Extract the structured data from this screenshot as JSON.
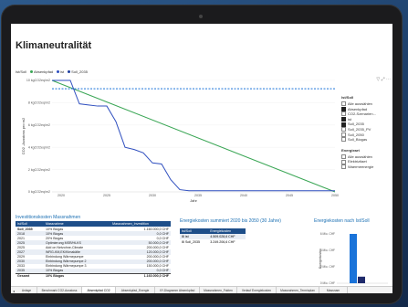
{
  "title": "Klimaneutralität",
  "legend": {
    "label": "Ist/Soll",
    "items": [
      {
        "label": "Absenkpfad",
        "color": "#3aa655"
      },
      {
        "label": "ist",
        "color": "#2f4fbf"
      },
      {
        "label": "Soll_2035",
        "color": "#1f3f9f"
      }
    ]
  },
  "chart_data": [
    {
      "type": "line",
      "ylabel": "CO2 -Ausstoss pro m2",
      "xlabel": "Jahr",
      "yticks": [
        "10 kgCO2eq/m2",
        "8 kgCO2eq/m2",
        "6 kgCO2eq/m2",
        "4 kgCO2eq/m2",
        "2 kgCO2eq/m2",
        "0 kgCO2eq/m2"
      ],
      "xticks": [
        "2020",
        "2025",
        "2030",
        "2035",
        "2040",
        "2045",
        "2050"
      ],
      "ylim": [
        0,
        10
      ],
      "xlim": [
        2019,
        2050
      ],
      "series": [
        {
          "name": "Absenkpfad",
          "color": "#3aa655",
          "style": "solid",
          "x": [
            2019,
            2050
          ],
          "y": [
            10,
            0
          ]
        },
        {
          "name": "ist",
          "color": "#2f4fbf",
          "style": "solid",
          "x": [
            2019,
            2021,
            2022,
            2023,
            2024,
            2025,
            2026,
            2027,
            2028,
            2029,
            2030,
            2031,
            2032,
            2033,
            2034,
            2035,
            2050
          ],
          "y": [
            10,
            10,
            7.9,
            7.8,
            7.7,
            7.7,
            6.3,
            4.0,
            3.8,
            3.5,
            2.6,
            2.5,
            1.1,
            0.2,
            0.1,
            0.1,
            0.1
          ]
        },
        {
          "name": "Soll_2035",
          "color": "#1a73d9",
          "style": "dashed",
          "x": [
            2019,
            2050
          ],
          "y": [
            9.25,
            9.25
          ]
        }
      ]
    },
    {
      "type": "bar",
      "title": "Energiekosten nach Ist/Soll",
      "ylabel": "Energiekosten",
      "yticks": [
        "6 Mio. CHF",
        "4 Mio. CHF",
        "2 Mio. CHF",
        "0 Mio. CHF"
      ],
      "ylim": [
        0,
        6
      ],
      "series": [
        {
          "name": "ist",
          "values": [
            6.0
          ],
          "color": "#1a73d9"
        },
        {
          "name": "Soll_2035",
          "values": [
            0.8
          ],
          "color": "#1f2a6b"
        }
      ]
    }
  ],
  "right_panel": {
    "icons": [
      "filter-icon",
      "focus-icon",
      "more-icon"
    ],
    "istsoll_header": "Ist/Soll",
    "istsoll_items": [
      {
        "label": "Alle auswählen",
        "checked": false
      },
      {
        "label": "Absenkpfad",
        "checked": true
      },
      {
        "label": "CO2-Szenarien...",
        "checked": false
      },
      {
        "label": "ist",
        "checked": true
      },
      {
        "label": "Soll_2035",
        "checked": true
      },
      {
        "label": "Soll_2035_PV",
        "checked": false
      },
      {
        "label": "Soll_2050",
        "checked": false
      },
      {
        "label": "Soll_Biogas",
        "checked": false
      }
    ],
    "energieart_header": "Energieart",
    "energieart_items": [
      {
        "label": "Alle auswählen",
        "checked": false
      },
      {
        "label": "Elektrizitaet",
        "checked": false
      },
      {
        "label": "Waermeenergie",
        "checked": false
      }
    ]
  },
  "investment": {
    "title": "Investitionskosten Massnahmen",
    "headers": [
      "Ist/Soll",
      "Massnahme",
      "Massnahmen_Investition"
    ],
    "rows": [
      [
        "Soll_2035",
        "10% Biogas",
        "1.160.000,0 CHF"
      ],
      [
        "2018",
        "10% Biogas",
        "0,0 CHF"
      ],
      [
        "2021",
        "20% Biogas",
        "0,0 CHF"
      ],
      [
        "2025",
        "Optimierung MSR/HLKS",
        "50.000,0 CHF"
      ],
      [
        "2025",
        "Add on Netzohne-Climate",
        "200.000,0 CHF"
      ],
      [
        "2027",
        "WRG-KM,EK/Kimakälte",
        "120.000,0 CHF"
      ],
      [
        "2029",
        "Einbindung Wärmepumpe",
        "200.000,0 CHF"
      ],
      [
        "2030",
        "Einbindung Wärmepumpe 2",
        "200.000,0 CHF"
      ],
      [
        "2033",
        "Einbindung Wärmepumpe 3",
        "150.000,0 CHF"
      ],
      [
        "2035",
        "10% Biogas",
        "0,0 CHF"
      ],
      [
        "Gesamt",
        "10% Biogas",
        "1.160.000,0 CHF"
      ]
    ]
  },
  "energy": {
    "title": "Energiekosten summiert 2020 bis 2050 (30 Jahre)",
    "headers": [
      "Ist/Soll",
      "Energiekosten"
    ],
    "rows": [
      [
        "ist",
        "4.509.028,6 CHF"
      ],
      [
        "Soll_2035",
        "3.249.206,6 CHF"
      ]
    ]
  },
  "tabs": [
    "Anlage",
    "Benchmark CO2-Ausstoss",
    "Absenkpfad CO2",
    "Absenkpfad_Energie",
    "XY-Diagramm Absenkpfad",
    "Massnahmen_Fakten",
    "Verlauf Energiekosten",
    "Massnahmen_Terminplan",
    "Massnam"
  ],
  "active_tab": 2
}
